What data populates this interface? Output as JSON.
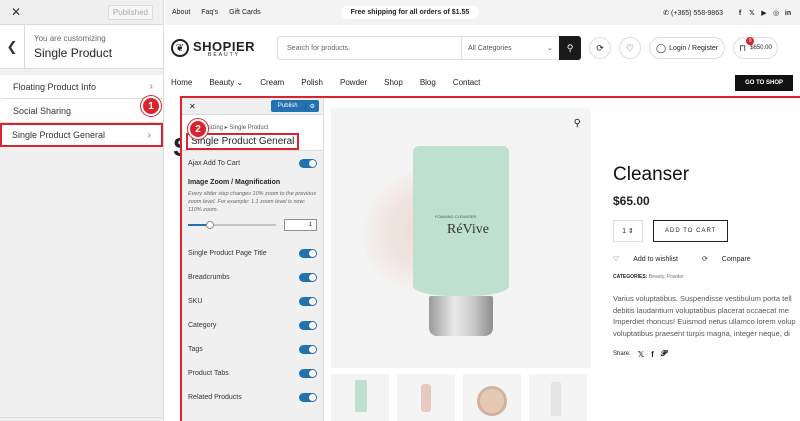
{
  "customizer": {
    "close_icon": "close-icon",
    "published_label": "Published",
    "customizing_label": "You are customizing",
    "section_title": "Single Product",
    "items": [
      {
        "label": "Floating Product Info"
      },
      {
        "label": "Social Sharing"
      },
      {
        "label": "Single Product General"
      }
    ]
  },
  "topbar": {
    "links": [
      "About",
      "Faq's",
      "Gift Cards"
    ],
    "shipping": "Free shipping for all orders of $1.55",
    "phone": "(+365) 558-9863"
  },
  "header": {
    "logo_name": "SHOPIER",
    "logo_sub": "BEAUTY",
    "search_placeholder": "Search for products.",
    "category": "All Categories",
    "login": "Login / Register",
    "cart_count": "0",
    "cart_total": "$650.00"
  },
  "nav": {
    "items": [
      "Home",
      "Beauty",
      "Cream",
      "Polish",
      "Powder",
      "Shop",
      "Blog",
      "Contact"
    ],
    "go_to_shop": "GO TO SHOP"
  },
  "floating_panel": {
    "publish": "Publish",
    "breadcrumb": "Customizing ▸ Single Product",
    "title": "Single Product General",
    "ajax_add_to_cart": "Ajax Add To Cart",
    "zoom_title": "Image Zoom / Magnification",
    "zoom_desc": "Every slider step changes 10% zoom to the previous zoom level. For example: 1.1 zoom level is now: 110% zoom.",
    "zoom_value": "1",
    "zoom_level_fraction": 0.25,
    "toggles": [
      {
        "label": "Single Product Page Title"
      },
      {
        "label": "Breadcrumbs"
      },
      {
        "label": "SKU"
      },
      {
        "label": "Category"
      },
      {
        "label": "Tags"
      },
      {
        "label": "Product Tabs"
      },
      {
        "label": "Related Products"
      }
    ]
  },
  "product": {
    "title": "Cleanser",
    "price": "$65.00",
    "qty": "1",
    "add_to_cart": "ADD TO CART",
    "wishlist": "Add to wishlist",
    "compare": "Compare",
    "categories_label": "CATEGORIES:",
    "categories_value": "Beauty, Powder",
    "brand_on_tube": "RéVive",
    "tube_text": "FOAMING CLEANSER",
    "description": [
      "Varius voluptatibus. Suspendisse vestibulum porta tell",
      "debitis laudantium voluptatibus placerat occaecat me",
      "Imperdiet rhoncus! Euismod netus ullamco lorem volup",
      "voluptatibus praesent turpis magna, integer neque, di"
    ],
    "share_label": "Share:"
  },
  "callouts": [
    "1",
    "2"
  ],
  "colors": {
    "accent_red": "#d9232e",
    "wp_blue": "#2271b1"
  }
}
